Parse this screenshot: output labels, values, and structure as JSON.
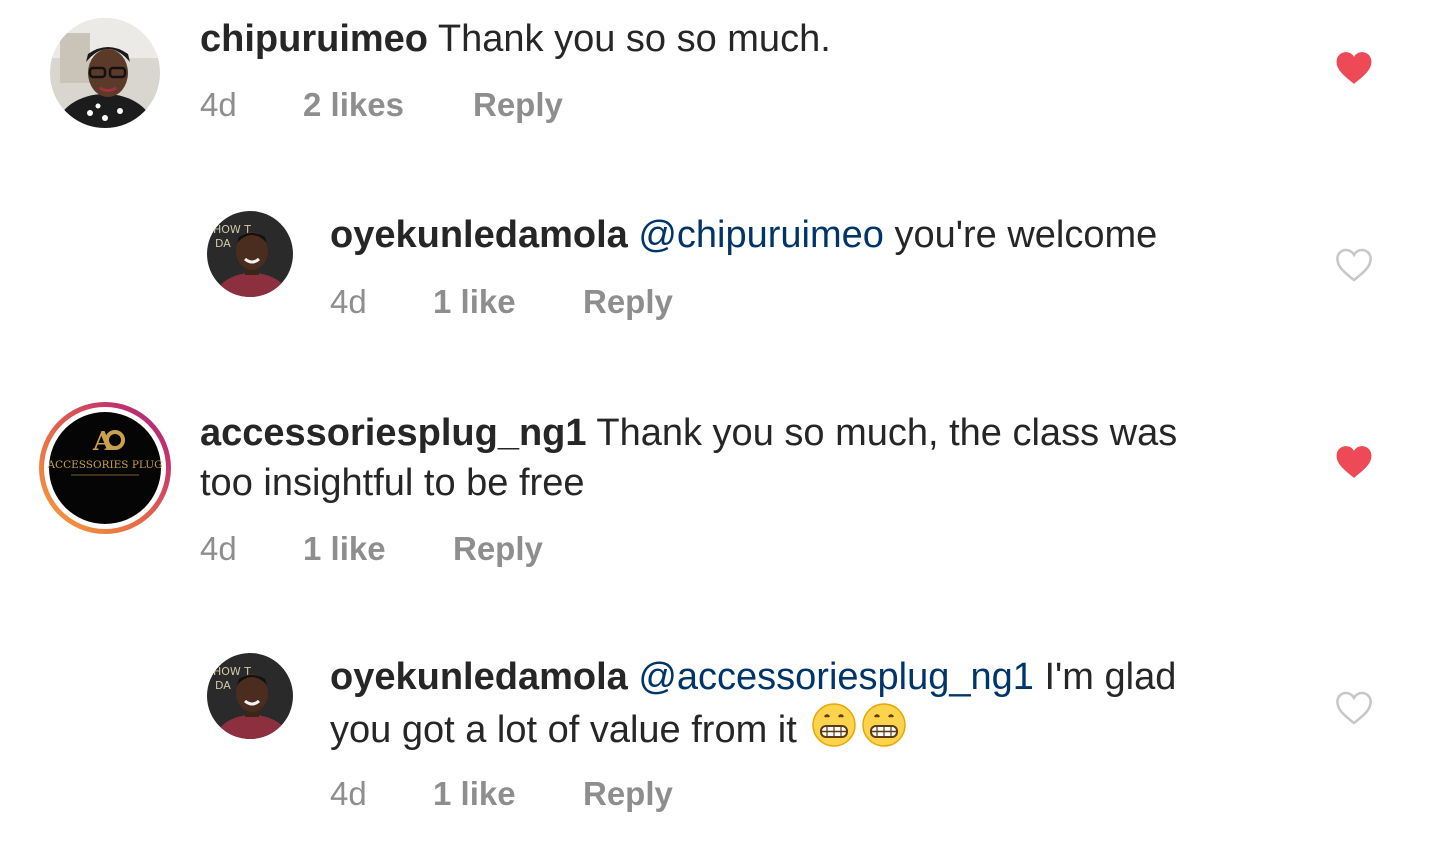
{
  "comments": [
    {
      "username": "chipuruimeo",
      "text": " Thank you so so much.",
      "time": "4d",
      "likes": "2 likes",
      "reply": "Reply",
      "liked": true
    },
    {
      "username": "oyekunledamola",
      "mention": "@chipuruimeo",
      "text": " you're welcome",
      "time": "4d",
      "likes": "1 like",
      "reply": "Reply",
      "liked": false
    },
    {
      "username": "accessoriesplug_ng1",
      "text_line1": " Thank you so much, the class was",
      "text_line2": "too insightful to be free",
      "time": "4d",
      "likes": "1 like",
      "reply": "Reply",
      "liked": true,
      "avatar_logo_text": "ACCESSORIES PLUG"
    },
    {
      "username": "oyekunledamola",
      "mention": "@accessoriesplug_ng1",
      "text_line1": " I'm glad",
      "text_line2": "you got a lot of value from it",
      "time": "4d",
      "likes": "1 like",
      "reply": "Reply",
      "liked": false
    }
  ],
  "colors": {
    "heart_liked": "#ed4956",
    "heart_outline": "#c7c7c7",
    "mention": "#003569",
    "meta": "#8e8e8e"
  },
  "icons": [
    "heart-filled-icon",
    "heart-outline-icon",
    "grinning-emoji-icon"
  ]
}
